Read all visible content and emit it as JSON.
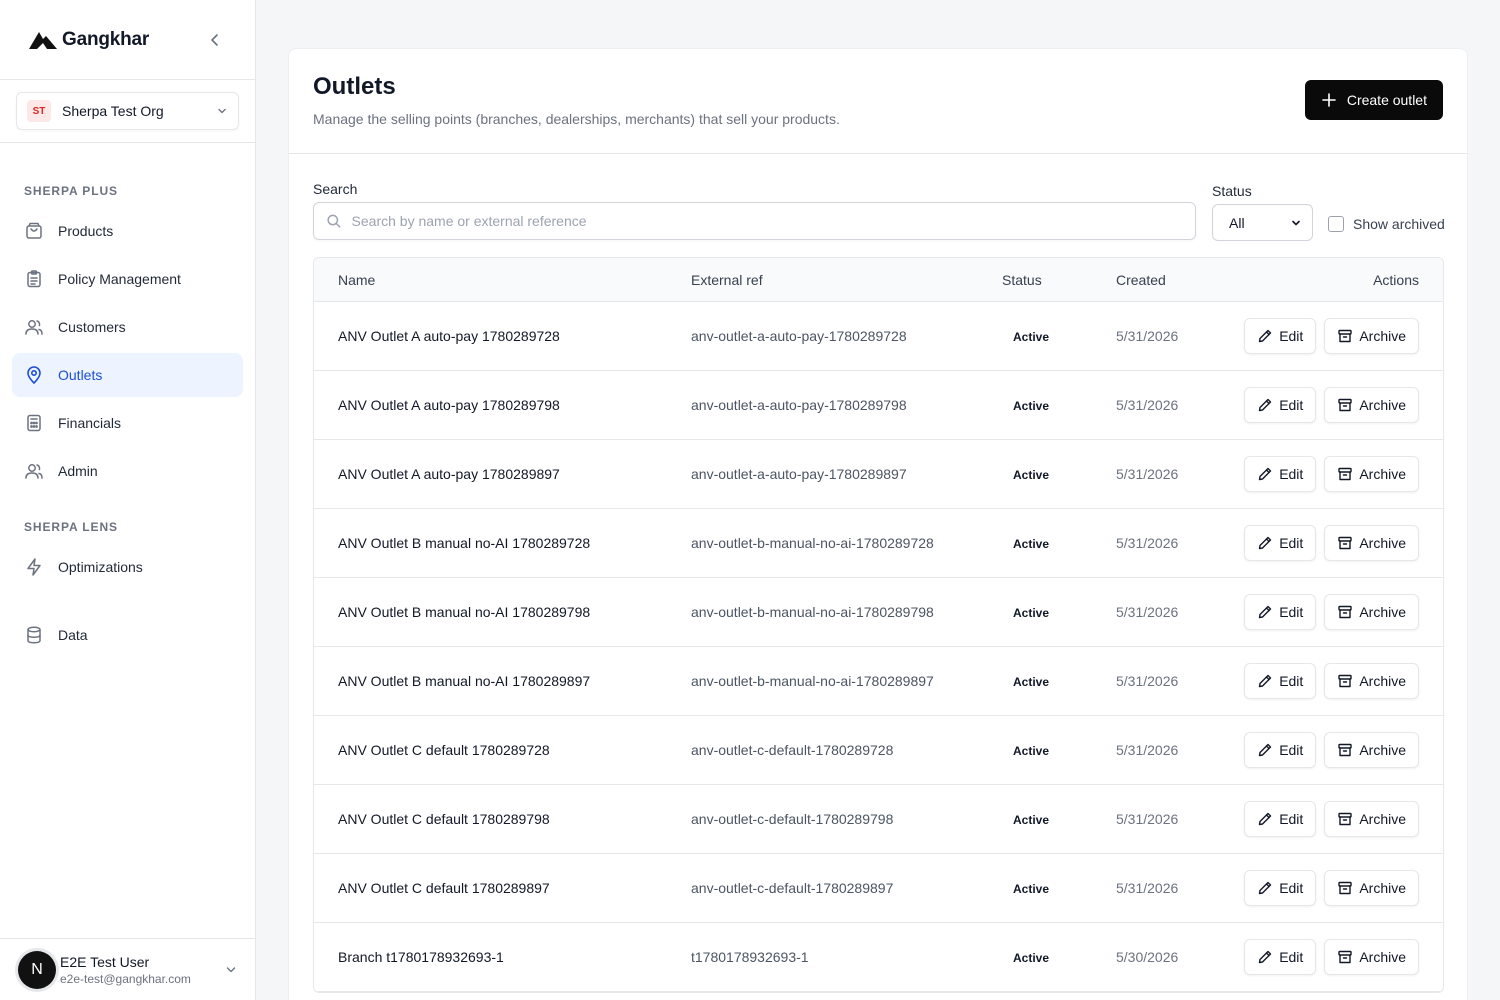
{
  "brand": {
    "name": "Gangkhar"
  },
  "org": {
    "badge": "ST",
    "name": "Sherpa Test Org"
  },
  "sidebar": {
    "sections": [
      {
        "title": "SHERPA PLUS",
        "items": [
          {
            "label": "Products",
            "icon": "shopping-bag-icon"
          },
          {
            "label": "Policy Management",
            "icon": "clipboard-icon"
          },
          {
            "label": "Customers",
            "icon": "users-icon"
          },
          {
            "label": "Outlets",
            "icon": "map-pin-icon",
            "active": true
          },
          {
            "label": "Financials",
            "icon": "calculator-icon"
          },
          {
            "label": "Admin",
            "icon": "users-icon"
          }
        ]
      },
      {
        "title": "SHERPA LENS",
        "items": [
          {
            "label": "Optimizations",
            "icon": "zap-icon"
          },
          {
            "label": "Data",
            "icon": "database-icon"
          }
        ]
      }
    ]
  },
  "user": {
    "initial": "N",
    "name": "E2E Test User",
    "email": "e2e-test@gangkhar.com"
  },
  "page": {
    "title": "Outlets",
    "subtitle": "Manage the selling points (branches, dealerships, merchants) that sell your products.",
    "create_label": "Create outlet"
  },
  "filters": {
    "search_label": "Search",
    "search_placeholder": "Search by name or external reference",
    "status_label": "Status",
    "status_value": "All",
    "show_archived_label": "Show archived"
  },
  "table": {
    "headers": {
      "name": "Name",
      "ref": "External ref",
      "status": "Status",
      "created": "Created",
      "actions": "Actions"
    },
    "edit_label": "Edit",
    "archive_label": "Archive",
    "rows": [
      {
        "name": "ANV Outlet A auto-pay 1780289728",
        "ref": "anv-outlet-a-auto-pay-1780289728",
        "status": "Active",
        "created": "5/31/2026"
      },
      {
        "name": "ANV Outlet A auto-pay 1780289798",
        "ref": "anv-outlet-a-auto-pay-1780289798",
        "status": "Active",
        "created": "5/31/2026"
      },
      {
        "name": "ANV Outlet A auto-pay 1780289897",
        "ref": "anv-outlet-a-auto-pay-1780289897",
        "status": "Active",
        "created": "5/31/2026"
      },
      {
        "name": "ANV Outlet B manual no-AI 1780289728",
        "ref": "anv-outlet-b-manual-no-ai-1780289728",
        "status": "Active",
        "created": "5/31/2026"
      },
      {
        "name": "ANV Outlet B manual no-AI 1780289798",
        "ref": "anv-outlet-b-manual-no-ai-1780289798",
        "status": "Active",
        "created": "5/31/2026"
      },
      {
        "name": "ANV Outlet B manual no-AI 1780289897",
        "ref": "anv-outlet-b-manual-no-ai-1780289897",
        "status": "Active",
        "created": "5/31/2026"
      },
      {
        "name": "ANV Outlet C default 1780289728",
        "ref": "anv-outlet-c-default-1780289728",
        "status": "Active",
        "created": "5/31/2026"
      },
      {
        "name": "ANV Outlet C default 1780289798",
        "ref": "anv-outlet-c-default-1780289798",
        "status": "Active",
        "created": "5/31/2026"
      },
      {
        "name": "ANV Outlet C default 1780289897",
        "ref": "anv-outlet-c-default-1780289897",
        "status": "Active",
        "created": "5/31/2026"
      },
      {
        "name": "Branch t1780178932693-1",
        "ref": "t1780178932693-1",
        "status": "Active",
        "created": "5/30/2026"
      }
    ]
  }
}
